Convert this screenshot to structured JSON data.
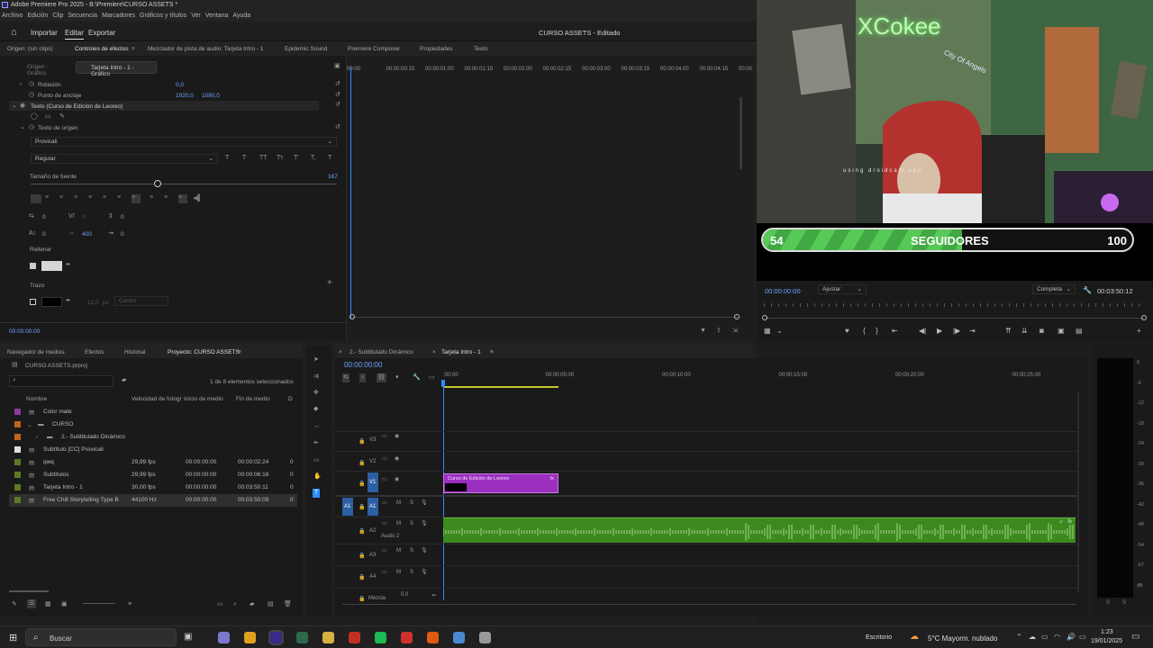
{
  "window": {
    "title": "Adobe Premiere Pro 2025 - B:\\Premiere\\CURSO ASSETS *",
    "menu": [
      "Archivo",
      "Edición",
      "Clip",
      "Secuencia",
      "Marcadores",
      "Gráficos y títulos",
      "Ver",
      "Ventana",
      "Ayuda"
    ],
    "project_title": "CURSO ASSETS - Editado"
  },
  "workspace": {
    "items": [
      "Importar",
      "Editar",
      "Exportar"
    ],
    "active": "Editar"
  },
  "top_tabs": [
    "Origen: (sin clips)",
    "Controles de efectos",
    "Mezclador de pista de audio: Tarjeta Intro - 1",
    "Epidemic Sound",
    "Premiere Composer",
    "Propiedades",
    "Texto"
  ],
  "effect_controls": {
    "source_tab": "Origen - Gráfico",
    "seq_tab": "Tarjeta Intro - 1 - Gráfico",
    "rotation_label": "Rotación",
    "rotation_value": "0,0",
    "anchor_label": "Punto de anclaje",
    "anchor_x": "1920,0",
    "anchor_y": "1080,0",
    "text_layer": "Texto (Curso de Edición de Leoreo)",
    "source_text": "Texto de origen",
    "font": "Provicali",
    "style": "Regular",
    "format_buttons": [
      "T",
      "T",
      "TT",
      "Tт",
      "T'",
      "T,",
      "T"
    ],
    "font_size_label": "Tamaño de fuente",
    "font_size_value": "167",
    "num_a": "0",
    "num_b": "0",
    "num_c": "0",
    "num_d": "0",
    "num_e": "400",
    "num_f": "0",
    "fill_label": "Rellenar",
    "stroke_label": "Trazo",
    "stroke_width": "12,0",
    "stroke_unit": "px",
    "stroke_pos": "Centro",
    "timecode": "00:00:00:00"
  },
  "ec_timeline": {
    "ticks": [
      "00:00",
      "00:00:00:15",
      "00:00:01:00",
      "00:00:01:15",
      "00:00:02:00",
      "00:00:02:15",
      "00:00:03:00",
      "00:00:03:15",
      "00:00:04:00",
      "00:00:04:15",
      "00:00"
    ]
  },
  "program": {
    "overlay_brand": "XCokee",
    "overlay_sign": "City Of Angels",
    "overlay_caption": "using droidcam.app",
    "followers_current": "54",
    "followers_label": "SEGUIDORES",
    "followers_goal": "100",
    "timecode": "00:00:00:00",
    "fit": "Ajustar",
    "quality": "Completa",
    "duration": "00:03:50:12"
  },
  "bottom_tabs": [
    "Navegador de medios",
    "Efectos",
    "Historial",
    "Proyecto: CURSO ASSETS"
  ],
  "project": {
    "file": "CURSO ASSETS.prproj",
    "selection": "1 de 8 elementos seleccionados",
    "columns": [
      "Nombre",
      "Velocidad de fotogr",
      "Inicio de medio",
      "Fin de medio",
      "D"
    ],
    "items": [
      {
        "name": "Color mate",
        "fps": "",
        "start": "",
        "end": "",
        "d": "",
        "color": "#8a3a9e"
      },
      {
        "name": "CURSO",
        "fps": "",
        "start": "",
        "end": "",
        "d": "",
        "color": "#c0651d"
      },
      {
        "name": "2.- Subtitulado Dinámico",
        "fps": "",
        "start": "",
        "end": "",
        "d": "",
        "color": "#c0651d"
      },
      {
        "name": "Subtítulo [CC] Provicali",
        "fps": "",
        "start": "",
        "end": "",
        "d": "",
        "color": "#e0e0e0"
      },
      {
        "name": "qwq",
        "fps": "29,99 fps",
        "start": "00:00:00:00",
        "end": "00:00:02:24",
        "d": "0",
        "color": "#5c7a27"
      },
      {
        "name": "Subtitulos",
        "fps": "29,99 fps",
        "start": "00:00:00:00",
        "end": "00:00:06:16",
        "d": "0",
        "color": "#5c7a27"
      },
      {
        "name": "Tarjeta Intro - 1",
        "fps": "30,00 fps",
        "start": "00:00:00:00",
        "end": "00:03:50:11",
        "d": "0",
        "color": "#5c7a27"
      },
      {
        "name": "Free Chill Storytelling Type B",
        "fps": "44100 Hz",
        "start": "00:00:00:00",
        "end": "00:03:50:09",
        "d": "0",
        "color": "#5c7a27"
      }
    ]
  },
  "timeline": {
    "tabs": [
      "2.- Subtitulado Dinámico",
      "Tarjeta Intro - 1"
    ],
    "timecode": "00:00:00:00",
    "ruler": [
      ":00:00",
      "00:00:05:00",
      "00:00:10:00",
      "00:00:15:00",
      "00:00:20:00",
      "00:00:25:00"
    ],
    "tracks_video": [
      "V3",
      "V2",
      "V1"
    ],
    "tracks_audio": [
      "A1",
      "A2",
      "A3",
      "A4"
    ],
    "audio2_label": "Audio 2",
    "mix_label": "Mezcla",
    "mix_value": "0,0",
    "clip_title": "Curso de Edición de Leoreo",
    "clip_fx": "fx"
  },
  "meter": {
    "scale": [
      "0",
      "-6",
      "-12",
      "-18",
      "-24",
      "-30",
      "-36",
      "-42",
      "-48",
      "-54",
      "-57",
      "dB"
    ],
    "footer": [
      "S",
      "S"
    ]
  },
  "taskbar": {
    "search": "Buscar",
    "desktop": "Escritorio",
    "weather": "5°C  Mayorm. nublado",
    "time": "1:23",
    "date": "19/01/2025"
  },
  "colors": {
    "accent": "#2d8cff",
    "clip_purple": "#9b2fc0",
    "audio_green": "#3c8a1e",
    "follower_green": "#4fbf4f"
  }
}
